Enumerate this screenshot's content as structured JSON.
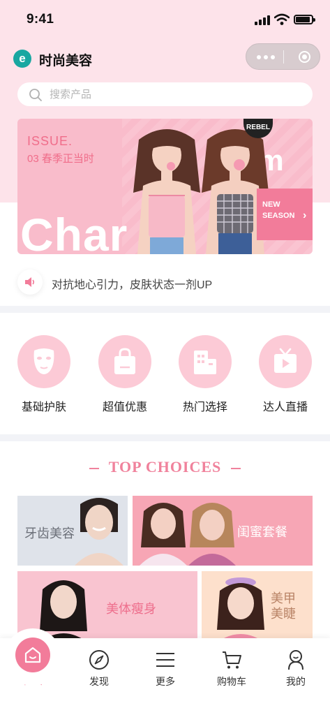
{
  "status_bar": {
    "time": "9:41"
  },
  "header": {
    "app_title": "时尚美容",
    "logo_letter": "e"
  },
  "search": {
    "placeholder": "搜索产品"
  },
  "banner": {
    "issue": "ISSUE.",
    "issue_sub": "03 春季正当时",
    "big_left": "Char",
    "big_right": "rm",
    "rebel": "REBEL",
    "season_line1": "NEW",
    "season_line2": "SEASON",
    "season_arrow": "›"
  },
  "notice": {
    "text": "对抗地心引力，皮肤状态一剂UP",
    "icon": "speaker-icon"
  },
  "categories": [
    {
      "label": "基础护肤",
      "icon": "face-mask-icon"
    },
    {
      "label": "超值优惠",
      "icon": "shopping-bag-icon"
    },
    {
      "label": "热门选择",
      "icon": "buildings-icon"
    },
    {
      "label": "达人直播",
      "icon": "tv-play-icon"
    }
  ],
  "top_choices": {
    "title": "TOP CHOICES",
    "tiles": [
      {
        "label": "牙齿美容"
      },
      {
        "label": "闺蜜套餐"
      },
      {
        "label": "美体瘦身"
      },
      {
        "label_line1": "美甲",
        "label_line2": "美睫"
      }
    ]
  },
  "tabbar": [
    {
      "label": "首页",
      "icon": "home-icon",
      "active": true
    },
    {
      "label": "发现",
      "icon": "compass-icon"
    },
    {
      "label": "更多",
      "icon": "menu-icon"
    },
    {
      "label": "购物车",
      "icon": "cart-icon"
    },
    {
      "label": "我的",
      "icon": "user-icon"
    }
  ],
  "colors": {
    "accent": "#f27c9a",
    "header_bg": "#fde3ea",
    "category_circle": "#fccad6"
  }
}
